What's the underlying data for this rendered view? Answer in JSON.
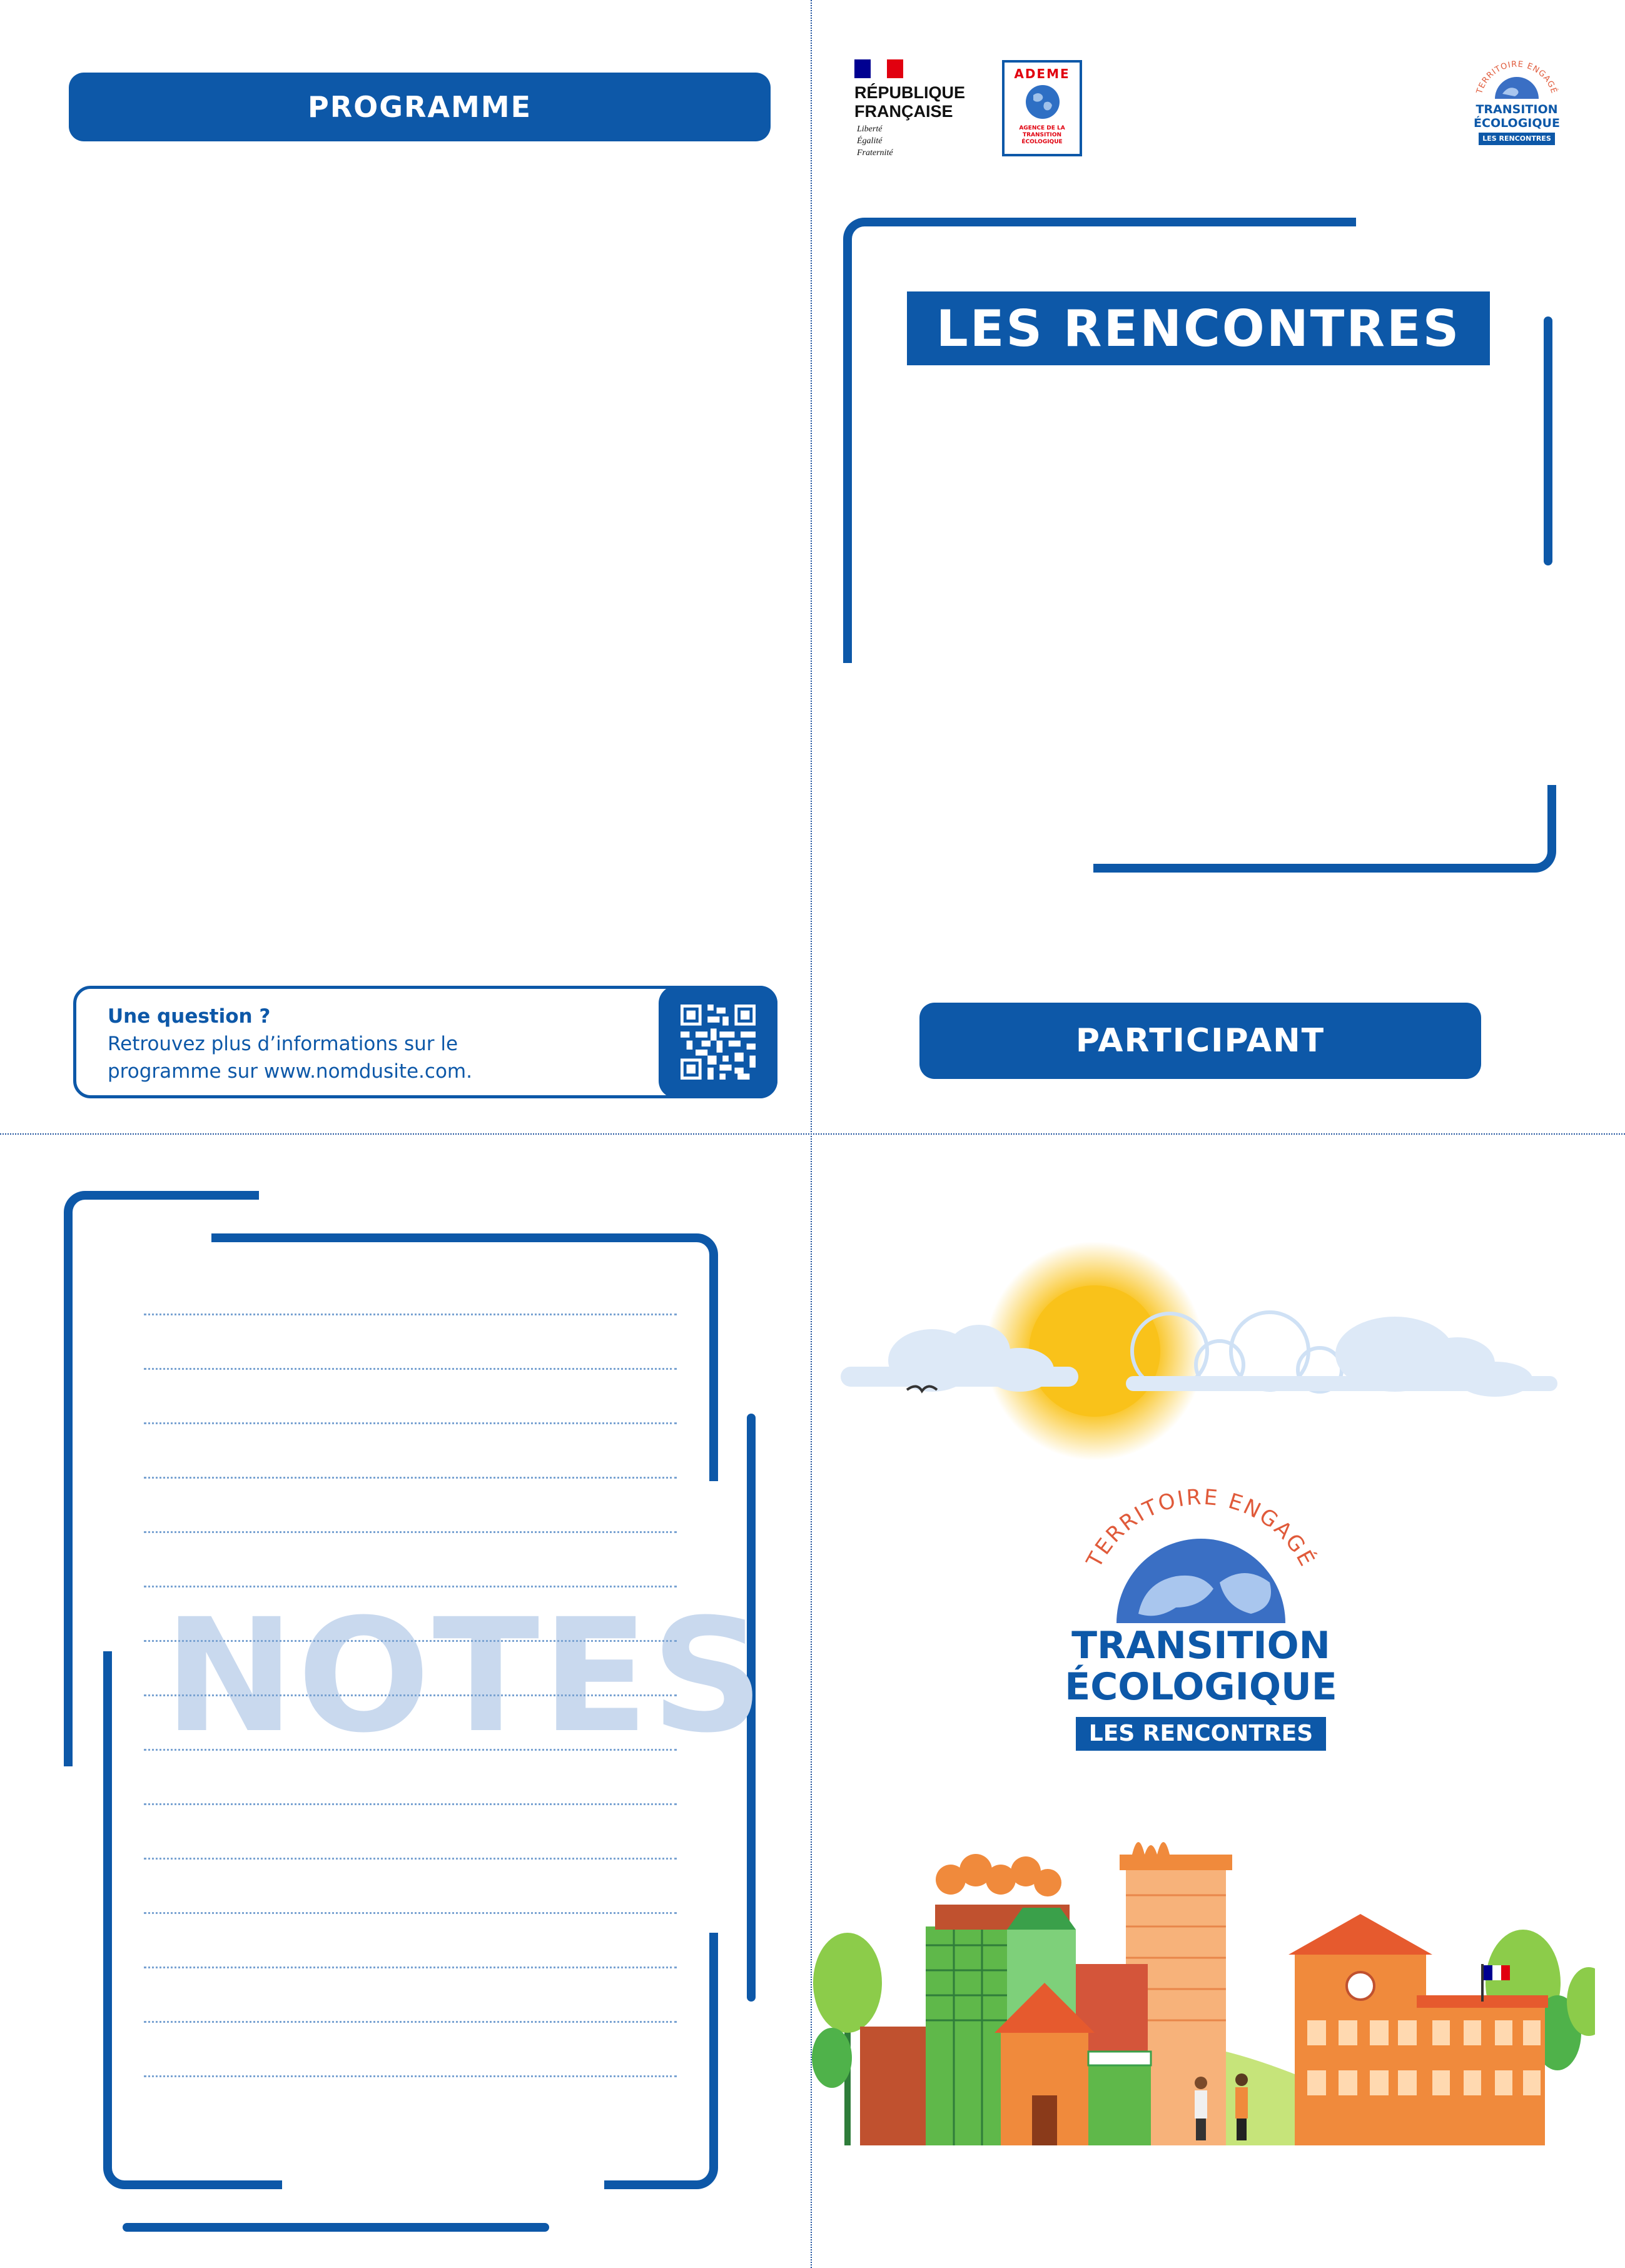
{
  "panels": {
    "programme": {
      "header_label": "PROGRAMME",
      "info": {
        "title": "Une question ?",
        "line1": "Retrouvez plus d’informations sur le",
        "line2": "programme sur www.nomdusite.com."
      }
    },
    "cover": {
      "gov_logo": {
        "line1": "RÉPUBLIQUE",
        "line2": "FRANÇAISE",
        "motto1": "Liberté",
        "motto2": "Égalité",
        "motto3": "Fraternité"
      },
      "ademe_logo": {
        "name": "ADEME",
        "sub": [
          "AGENCE DE LA",
          "TRANSITION",
          "ÉCOLOGIQUE"
        ]
      },
      "small_logo": {
        "arc": "TERRITOIRE ENGAGÉ",
        "line1": "TRANSITION",
        "line2": "ÉCOLOGIQUE",
        "band": "LES RENCONTRES"
      },
      "title": "LES RENCONTRES",
      "participant_label": "PARTICIPANT"
    },
    "notes": {
      "watermark": "NOTES",
      "line_count": 15
    },
    "back": {
      "logo": {
        "arc": "TERRITOIRE ENGAGÉ",
        "line1": "TRANSITION",
        "line2": "ÉCOLOGIQUE",
        "band": "LES RENCONTRES"
      }
    }
  },
  "colors": {
    "brand_blue": "#0d58a8",
    "watermark": "#c9d9ee",
    "accent_red": "#e1000f",
    "sun": "#f9c21a",
    "orange": "#f08a3c",
    "green": "#4fb24a"
  },
  "icons": [
    "qr-code-icon",
    "flag-icon",
    "globe-icon",
    "sun-icon",
    "cloud-icon",
    "bird-icon"
  ]
}
